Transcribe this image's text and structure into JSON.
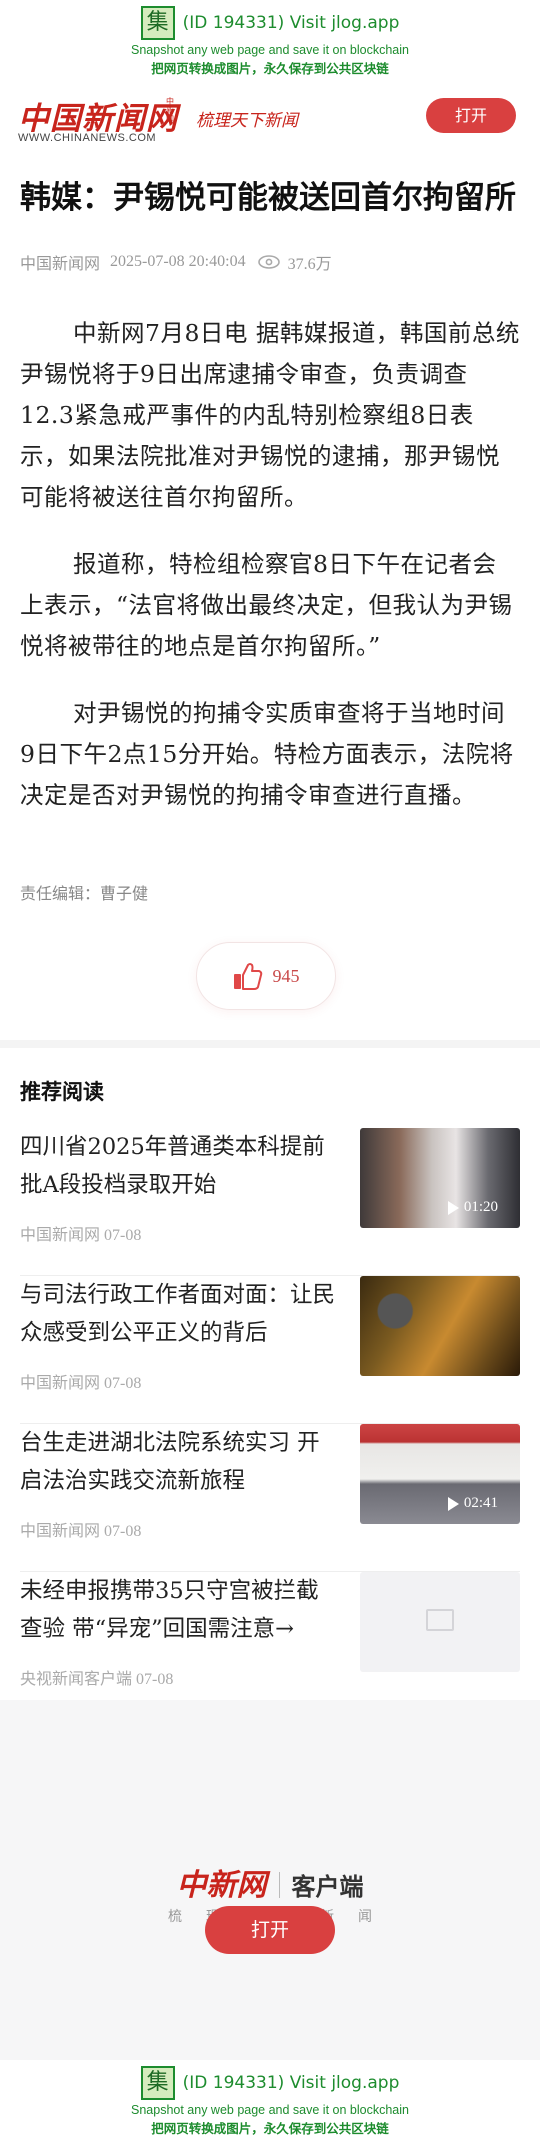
{
  "jlog_banner": {
    "icon_char": "集",
    "id_text": "(ID 194331) Visit jlog.app",
    "line2": "Snapshot any web page and save it on blockchain",
    "line3": "把网页转换成图片，永久保存到公共区块链"
  },
  "header": {
    "logo_cn": "中国新闻网",
    "logo_sub": "中新网",
    "logo_en": "WWW.CHINANEWS.COM",
    "slogan": "梳理天下新闻",
    "open_button": "打开"
  },
  "article": {
    "title": "韩媒：尹锡悦可能被送回首尔拘留所",
    "source": "中国新闻网",
    "datetime": "2025-07-08 20:40:04",
    "views": "37.6万",
    "paragraphs": [
      "中新网7月8日电 据韩媒报道，韩国前总统尹锡悦将于9日出席逮捕令审查，负责调查12.3紧急戒严事件的内乱特别检察组8日表示，如果法院批准对尹锡悦的逮捕，那尹锡悦可能将被送往首尔拘留所。",
      "报道称，特检组检察官8日下午在记者会上表示，“法官将做出最终决定，但我认为尹锡悦将被带往的地点是首尔拘留所。”",
      "对尹锡悦的拘捕令实质审查将于当地时间9日下午2点15分开始。特检方面表示，法院将决定是否对尹锡悦的拘捕令审查进行直播。"
    ],
    "editor": "责任编辑：曹子健",
    "likes": "945"
  },
  "recommend": {
    "heading": "推荐阅读",
    "items": [
      {
        "title": "四川省2025年普通类本科提前批A段投档录取开始",
        "meta": "中国新闻网 07-08",
        "duration": "01:20"
      },
      {
        "title": "与司法行政工作者面对面：让民众感受到公平正义的背后",
        "meta": "中国新闻网 07-08",
        "duration": ""
      },
      {
        "title": "台生走进湖北法院系统实习 开启法治实践交流新旅程",
        "meta": "中国新闻网 07-08",
        "duration": "02:41"
      },
      {
        "title": "未经申报携带35只守宫被拦截查验 带“异宠”回国需注意→",
        "meta": "央视新闻客户端 07-08",
        "duration": ""
      }
    ]
  },
  "promo": {
    "brand": "中新网",
    "client": "客户端",
    "tagline": "梳理天下新闻",
    "open_button": "打开"
  },
  "colors": {
    "accent_red": "#d94040",
    "jlog_green": "#1d8c2e"
  }
}
